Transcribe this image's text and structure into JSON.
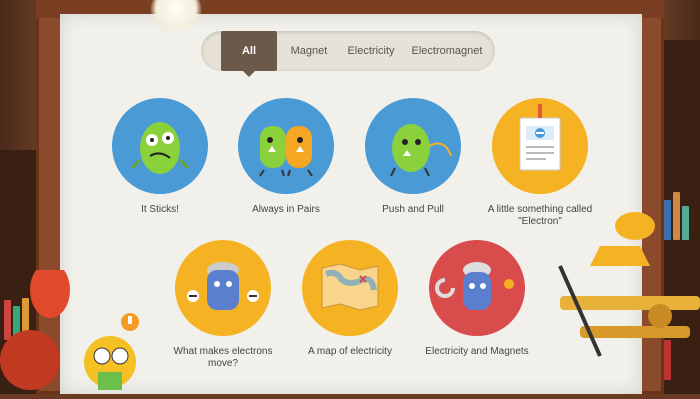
{
  "tabs": [
    {
      "label": "All",
      "active": true
    },
    {
      "label": "Magnet",
      "active": false
    },
    {
      "label": "Electricity",
      "active": false
    },
    {
      "label": "Electromagnet",
      "active": false
    }
  ],
  "topics": [
    {
      "label": "It Sticks!",
      "color": "#4a9ad6",
      "icon": "green-germ-sticky-icon"
    },
    {
      "label": "Always in Pairs",
      "color": "#4a9ad6",
      "icon": "paired-characters-icon"
    },
    {
      "label": "Push and Pull",
      "color": "#4a9ad6",
      "icon": "green-character-pushing-icon"
    },
    {
      "label": "A little something called \"Electron\"",
      "color": "#f5b323",
      "icon": "electron-poster-icon"
    },
    {
      "label": "What makes electrons move?",
      "color": "#f5b323",
      "icon": "battery-character-icon"
    },
    {
      "label": "A map of electricity",
      "color": "#f5b323",
      "icon": "map-icon"
    },
    {
      "label": "Electricity and Magnets",
      "color": "#d94c4c",
      "icon": "magnet-character-icon"
    }
  ],
  "colors": {
    "blue": "#4a9ad6",
    "yellow": "#f5b323",
    "red": "#d94c4c",
    "tab_active": "#6b5a4a"
  }
}
